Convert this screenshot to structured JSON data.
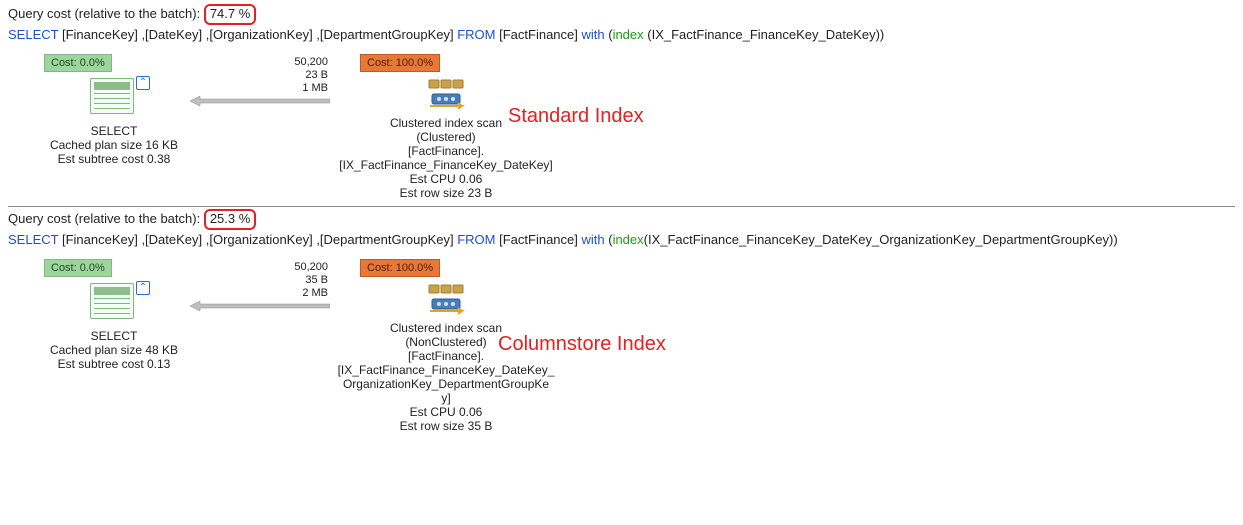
{
  "q1": {
    "cost_prefix": "Query cost (relative to the batch): ",
    "cost_pct": "74.7 %",
    "sql_select": "SELECT",
    "sql_cols": " [FinanceKey] ,[DateKey] ,[OrganizationKey] ,[DepartmentGroupKey] ",
    "sql_from": "FROM",
    "sql_table": " [FactFinance] ",
    "sql_with": "with",
    "sql_idx_open": " (",
    "sql_index_kw": "index",
    "sql_idx_body": " (IX_FactFinance_FinanceKey_DateKey))",
    "annotation": "Standard Index",
    "select": {
      "cost": "Cost: 0.0%",
      "title": "SELECT",
      "line1": "Cached plan size  16 KB",
      "line2": "Est subtree cost  0.38"
    },
    "edge": {
      "rows": "50,200",
      "rowsize": "23 B",
      "bytes": "1 MB"
    },
    "scan": {
      "cost": "Cost: 100.0%",
      "title": "Clustered index scan",
      "l1": "(Clustered)",
      "l2": "[FactFinance].",
      "l3": "[IX_FactFinance_FinanceKey_DateKey]",
      "l4": "Est CPU  0.06",
      "l5": "Est row size  23 B"
    }
  },
  "q2": {
    "cost_prefix": "Query cost (relative to the batch): ",
    "cost_pct": "25.3 %",
    "sql_select": "SELECT",
    "sql_cols": " [FinanceKey] ,[DateKey] ,[OrganizationKey] ,[DepartmentGroupKey] ",
    "sql_from": "FROM",
    "sql_table": " [FactFinance] ",
    "sql_with": "with",
    "sql_idx_open": " (",
    "sql_index_kw": "index",
    "sql_idx_body": "(IX_FactFinance_FinanceKey_DateKey_OrganizationKey_DepartmentGroupKey))",
    "annotation": "Columnstore Index",
    "select": {
      "cost": "Cost: 0.0%",
      "title": "SELECT",
      "line1": "Cached plan size  48 KB",
      "line2": "Est subtree cost  0.13"
    },
    "edge": {
      "rows": "50,200",
      "rowsize": "35 B",
      "bytes": "2 MB"
    },
    "scan": {
      "cost": "Cost: 100.0%",
      "title": "Clustered index scan",
      "l1": "(NonClustered)",
      "l2": "[FactFinance].",
      "l3a": "[IX_FactFinance_FinanceKey_DateKey_",
      "l3b": "OrganizationKey_DepartmentGroupKe",
      "l3c": "y]",
      "l4": "Est CPU  0.06",
      "l5": "Est row size  35 B"
    }
  }
}
